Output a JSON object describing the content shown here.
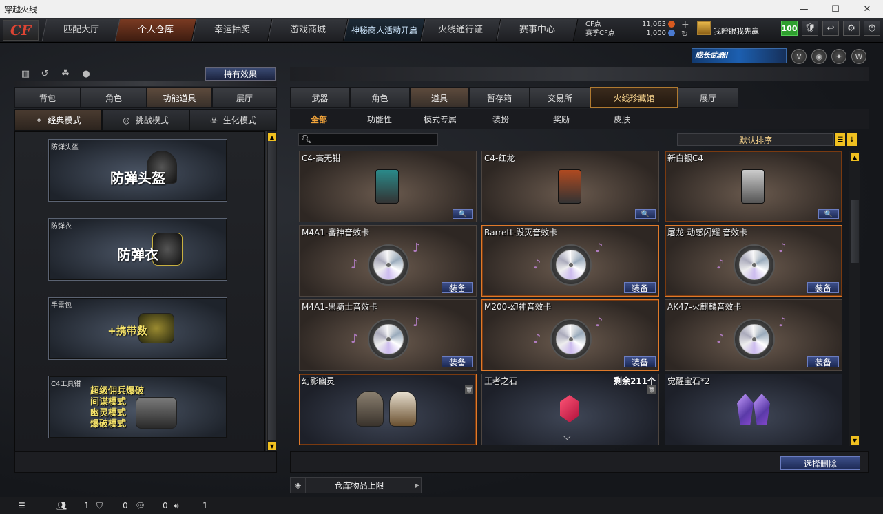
{
  "window": {
    "title": "穿越火线",
    "minimize": "—",
    "maximize": "☐",
    "close": "✕"
  },
  "logo": {
    "text": "CF"
  },
  "nav": {
    "tabs": [
      {
        "label": "匹配大厅"
      },
      {
        "label": "个人仓库"
      },
      {
        "label": "幸运抽奖"
      },
      {
        "label": "游戏商城"
      },
      {
        "label": "神秘商人活动开启"
      },
      {
        "label": "火线通行证"
      },
      {
        "label": "赛事中心"
      }
    ],
    "active_index": 1
  },
  "currency": {
    "cf_label": "CF点",
    "cf_value": "11,063",
    "season_label": "赛季CF点",
    "season_value": "1,000"
  },
  "user": {
    "name": "我瞪眼我先赢",
    "level": "100"
  },
  "top_buttons": {
    "shield": "🛡",
    "back": "↩",
    "settings": "⚙",
    "power": "⏻"
  },
  "banner": {
    "growth_text": "成长武器!"
  },
  "left": {
    "effect_button": "持有效果",
    "tabs": [
      {
        "label": "背包"
      },
      {
        "label": "角色"
      },
      {
        "label": "功能道具"
      },
      {
        "label": "展厅"
      }
    ],
    "active_tab": 2,
    "modes": [
      {
        "label": "经典模式",
        "icon": "✧"
      },
      {
        "label": "挑战模式",
        "icon": "◎"
      },
      {
        "label": "生化模式",
        "icon": "☣"
      }
    ],
    "active_mode": 0,
    "slots": [
      {
        "label": "防弹头盔",
        "big": "防弹头盔"
      },
      {
        "label": "防弹衣",
        "big": "防弹衣"
      },
      {
        "label": "手雷包",
        "big": "+携带数"
      },
      {
        "label": "C4工具钳",
        "lines": [
          "超级佣兵爆破",
          "间谍模式",
          "幽灵模式",
          "爆破模式"
        ]
      }
    ]
  },
  "right": {
    "tabs": [
      {
        "label": "武器"
      },
      {
        "label": "角色"
      },
      {
        "label": "道具"
      },
      {
        "label": "暂存箱"
      },
      {
        "label": "交易所"
      },
      {
        "label": "火线珍藏馆"
      },
      {
        "label": "展厅"
      }
    ],
    "active_tab": 2,
    "subtabs": [
      {
        "label": "全部"
      },
      {
        "label": "功能性"
      },
      {
        "label": "模式专属"
      },
      {
        "label": "装扮"
      },
      {
        "label": "奖励"
      },
      {
        "label": "皮肤"
      }
    ],
    "active_subtab": 0,
    "search_placeholder": "",
    "sort_label": "默认排序",
    "items": [
      {
        "name": "C4-高无钳",
        "button": "🔍"
      },
      {
        "name": "C4-红龙",
        "button": "🔍"
      },
      {
        "name": "新白银C4",
        "button": "🔍"
      },
      {
        "name": "M4A1-審神音效卡",
        "button": "装备"
      },
      {
        "name": "Barrett-毁灭音效卡",
        "button": "装备"
      },
      {
        "name": "屠龙-动感闪耀 音效卡",
        "button": "装备"
      },
      {
        "name": "M4A1-黑骑士音效卡",
        "button": "装备"
      },
      {
        "name": "M200-幻神音效卡",
        "button": "装备"
      },
      {
        "name": "AK47-火麒麟音效卡",
        "button": "装备"
      },
      {
        "name": "幻影幽灵",
        "trash": "🗑"
      },
      {
        "name": "王者之石",
        "remaining": "剩余211个",
        "trash": "🗑"
      },
      {
        "name": "觉醒宝石*2"
      }
    ],
    "select_delete": "选择删除",
    "capacity_label": "仓库物品上限"
  },
  "statusbar": {
    "a": "1",
    "b": "0",
    "c": "0",
    "d": "1"
  }
}
